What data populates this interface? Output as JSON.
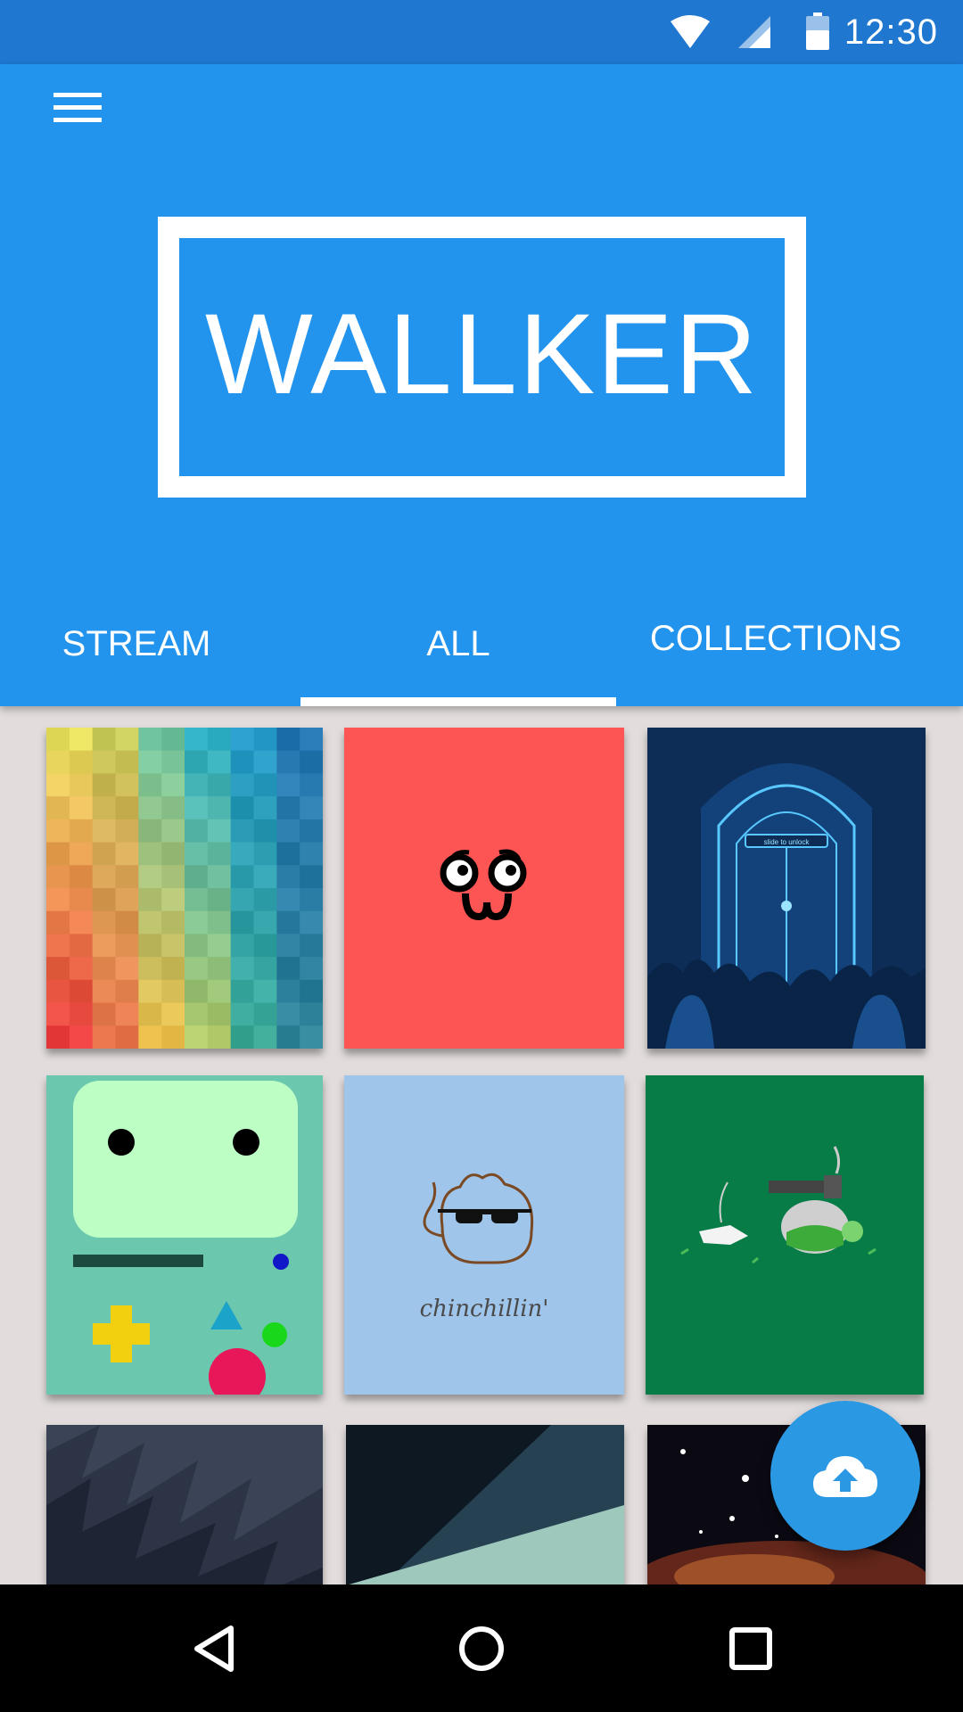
{
  "status_bar": {
    "time": "12:30",
    "icons": [
      "wifi-icon",
      "cellular-signal-icon",
      "battery-icon"
    ]
  },
  "app_bar": {
    "menu_icon": "hamburger-menu-icon",
    "logo": "WALLKER",
    "color": "#2394ee"
  },
  "tabs": [
    {
      "label": "STREAM",
      "selected": false
    },
    {
      "label": "ALL",
      "selected": true
    },
    {
      "label": "COLLECTIONS",
      "selected": false
    }
  ],
  "wallpapers": {
    "tile_4_text": "chinchillin'",
    "tile_3_text": "slide to unlock"
  },
  "fab": {
    "icon": "cloud-upload-icon",
    "color": "#2a98e2"
  },
  "nav_bar": {
    "icons": [
      "back-icon",
      "home-icon",
      "recents-icon"
    ]
  }
}
